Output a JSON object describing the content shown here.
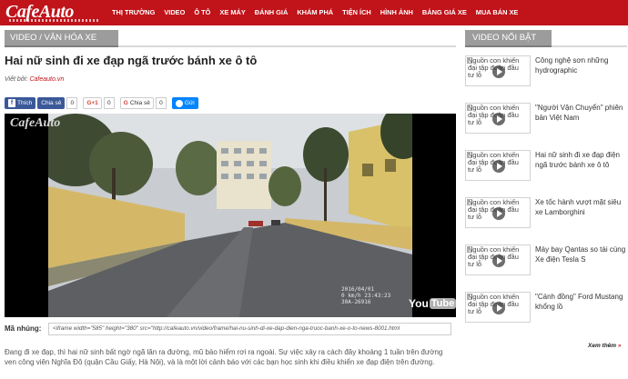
{
  "site": {
    "logo": "CafeAuto",
    "nav": [
      "THỊ TRƯỜNG",
      "VIDEO",
      "Ô TÔ",
      "XE MÁY",
      "ĐÁNH GIÁ",
      "KHÁM PHÁ",
      "TIỆN ÍCH",
      "HÌNH ẢNH",
      "BẢNG GIÁ XE",
      "MUA BÁN XE"
    ]
  },
  "article": {
    "category": "VIDEO / VĂN HÓA XE",
    "title": "Hai nữ sinh đi xe đạp ngã trước bánh xe ô tô",
    "byline_prefix": "Viết bởi:",
    "byline_source": "Cafeauto.vn",
    "lead": "Đang đi xe đạp, thì hai nữ sinh bất ngờ ngã lăn ra đường, mũ bảo hiểm rơi ra ngoài. Sự việc xảy ra cách đây khoảng 1 tuần trên đường ven công viên Nghĩa Đô (quận Cầu Giấy, Hà Nội), và là một lời cảnh báo với các bạn học sinh khi điều khiển xe đạp điện trên đường."
  },
  "share": {
    "fb_like": "Thích",
    "fb_share": "Chia sẻ",
    "fb_count": "0",
    "gplus": "G+1",
    "gplus_count": "0",
    "gshare": "Chia sẻ",
    "gshare_count": "0",
    "messenger": "Gửi"
  },
  "video": {
    "watermark": "CafeAuto",
    "date": "2016/04/01",
    "speed_time": "0 km/h 23:43:23",
    "plate": "30A-26916",
    "yt_you": "You",
    "yt_tube": "Tube"
  },
  "embed": {
    "label": "Mã nhúng:",
    "code": "<iframe width=\"585\" height=\"380\" src=\"http://cafeauto.vn/video/frame/hai-nu-sinh-di-xe-dap-dien-nga-truoc-banh-xe-o-to-news-8001.html"
  },
  "sidebar": {
    "title": "VIDEO NỔI BẬT",
    "thumb_alt": "Nguồn con khiến đại tập đoàn đầu tư lỗ",
    "items": [
      {
        "title": "Công nghệ sơn những hydrographic"
      },
      {
        "title": "\"Người Vận Chuyển\" phiên bản Việt Nam"
      },
      {
        "title": "Hai nữ sinh đi xe đạp điện ngã trước bánh xe ô tô"
      },
      {
        "title": "Xe tốc hành vượt mặt siêu xe Lamborghini"
      },
      {
        "title": "Máy bay Qantas so tài cùng Xe điện Tesla S"
      },
      {
        "title": "\"Cánh đồng\" Ford Mustang khổng lồ"
      }
    ],
    "see_more": "Xem thêm"
  },
  "colors": {
    "brand": "#c0131a",
    "section_bar": "#9c9c9c",
    "facebook": "#3b5998",
    "messenger": "#0084ff"
  }
}
